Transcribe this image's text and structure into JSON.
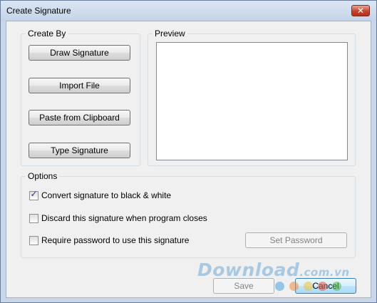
{
  "window": {
    "title": "Create Signature",
    "close_glyph": "✕"
  },
  "create_by": {
    "label": "Create By",
    "buttons": [
      "Draw Signature",
      "Import File",
      "Paste from Clipboard",
      "Type Signature"
    ]
  },
  "preview": {
    "label": "Preview"
  },
  "options": {
    "label": "Options",
    "convert_bw": {
      "label": "Convert signature to black & white",
      "checked": true
    },
    "discard": {
      "label": "Discard this signature when program closes",
      "checked": false
    },
    "require_password": {
      "label": "Require password to use this signature",
      "checked": false
    },
    "set_password_label": "Set Password"
  },
  "footer": {
    "save_label": "Save",
    "cancel_label": "Cancel"
  },
  "watermark": {
    "text": "Download",
    "suffix": ".com.vn"
  },
  "colors": {
    "dot_1": "#4fa3e0",
    "dot_2": "#f08a3c",
    "dot_3": "#f3c23a",
    "dot_4": "#e8574a",
    "dot_5": "#54b84f"
  },
  "icons": {
    "close": "close-icon",
    "check": "checkmark-icon"
  }
}
